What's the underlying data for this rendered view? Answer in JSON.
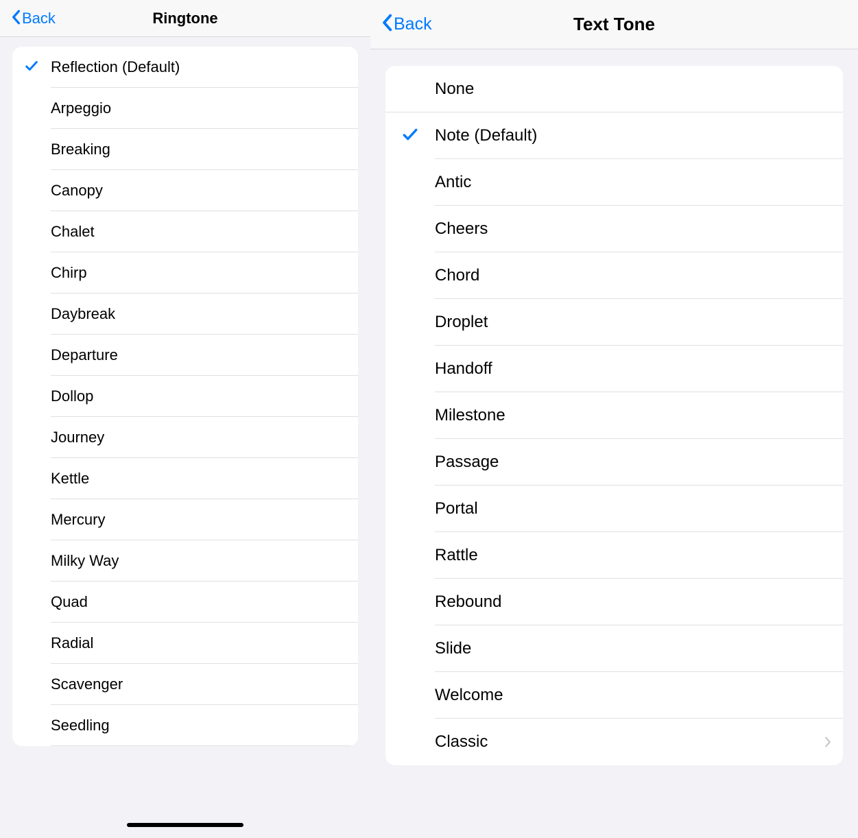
{
  "left": {
    "back_label": "Back",
    "title": "Ringtone",
    "items": [
      {
        "label": "Reflection (Default)",
        "selected": true
      },
      {
        "label": "Arpeggio",
        "selected": false
      },
      {
        "label": "Breaking",
        "selected": false
      },
      {
        "label": "Canopy",
        "selected": false
      },
      {
        "label": "Chalet",
        "selected": false
      },
      {
        "label": "Chirp",
        "selected": false
      },
      {
        "label": "Daybreak",
        "selected": false
      },
      {
        "label": "Departure",
        "selected": false
      },
      {
        "label": "Dollop",
        "selected": false
      },
      {
        "label": "Journey",
        "selected": false
      },
      {
        "label": "Kettle",
        "selected": false
      },
      {
        "label": "Mercury",
        "selected": false
      },
      {
        "label": "Milky Way",
        "selected": false
      },
      {
        "label": "Quad",
        "selected": false
      },
      {
        "label": "Radial",
        "selected": false
      },
      {
        "label": "Scavenger",
        "selected": false
      },
      {
        "label": "Seedling",
        "selected": false
      }
    ]
  },
  "right": {
    "back_label": "Back",
    "title": "Text Tone",
    "items": [
      {
        "label": "None",
        "selected": false,
        "full_sep": true
      },
      {
        "label": "Note (Default)",
        "selected": true
      },
      {
        "label": "Antic",
        "selected": false
      },
      {
        "label": "Cheers",
        "selected": false
      },
      {
        "label": "Chord",
        "selected": false
      },
      {
        "label": "Droplet",
        "selected": false
      },
      {
        "label": "Handoff",
        "selected": false
      },
      {
        "label": "Milestone",
        "selected": false
      },
      {
        "label": "Passage",
        "selected": false
      },
      {
        "label": "Portal",
        "selected": false
      },
      {
        "label": "Rattle",
        "selected": false
      },
      {
        "label": "Rebound",
        "selected": false
      },
      {
        "label": "Slide",
        "selected": false
      },
      {
        "label": "Welcome",
        "selected": false
      },
      {
        "label": "Classic",
        "selected": false,
        "disclosure": true
      }
    ]
  }
}
